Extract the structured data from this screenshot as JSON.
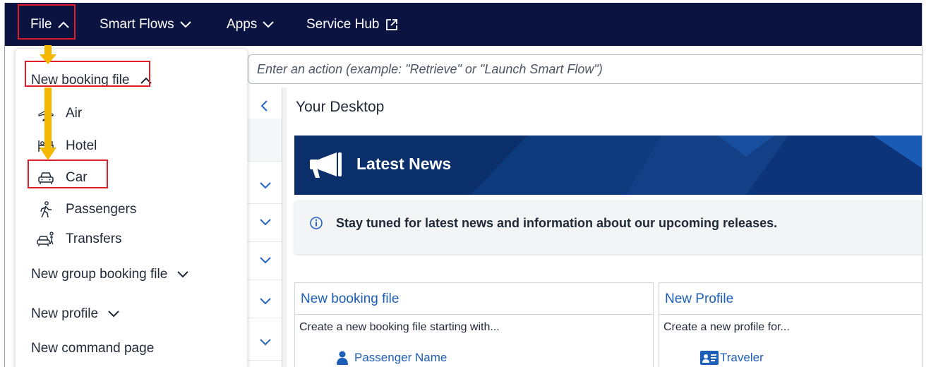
{
  "topnav": {
    "file": "File",
    "smart_flows": "Smart Flows",
    "apps": "Apps",
    "service_hub": "Service Hub"
  },
  "menu": {
    "new_booking_file": "New booking file",
    "items": {
      "air": "Air",
      "hotel": "Hotel",
      "car": "Car",
      "passengers": "Passengers",
      "transfers": "Transfers"
    },
    "new_group_booking_file": "New group booking file",
    "new_profile": "New profile",
    "new_command_page": "New command page"
  },
  "action_bar": {
    "placeholder": "Enter an action (example: \"Retrieve\" or \"Launch Smart Flow\")"
  },
  "desktop": {
    "title": "Your Desktop",
    "news_title": "Latest News",
    "info_text": "Stay tuned for latest news and information about our upcoming releases."
  },
  "cards": {
    "booking": {
      "title": "New booking file",
      "desc": "Create a new booking file starting with...",
      "link": "Passenger Name"
    },
    "profile": {
      "title": "New Profile",
      "desc": "Create a new profile for...",
      "link": "Traveler"
    }
  },
  "colors": {
    "nav_bg": "#0b1340",
    "highlight": "#e11d2a",
    "arrow": "#f5b800",
    "link": "#1d5fb8",
    "banner": "#0a2f6b"
  }
}
